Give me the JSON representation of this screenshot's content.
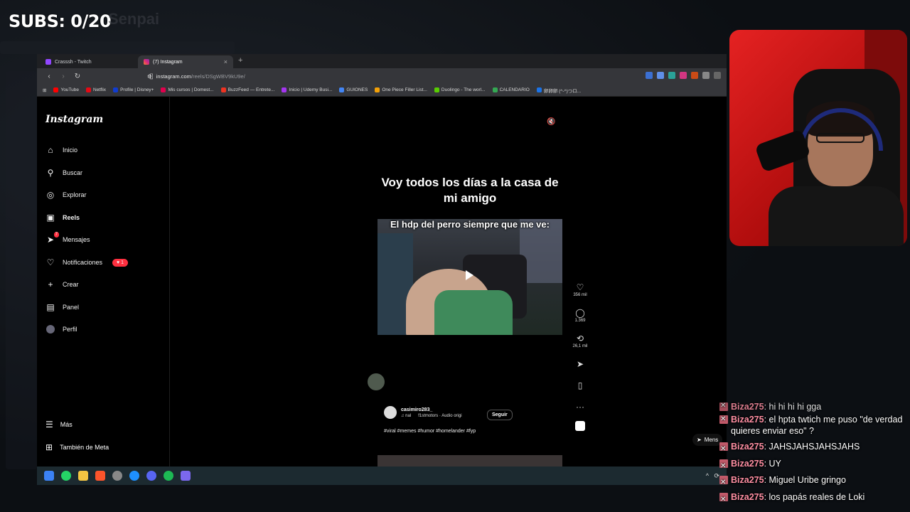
{
  "overlay": {
    "subs_label": "SUBS: 0/20",
    "channel_ghost": "Senpai"
  },
  "browser": {
    "tabs": [
      {
        "label": "Crasssh - Twitch",
        "active": false
      },
      {
        "label": "(7) Instagram",
        "active": true
      }
    ],
    "url_host": "instagram.com",
    "url_path": "/reels/DSgWBV9kU9e/",
    "bookmarks": [
      "YouTube",
      "Netflix",
      "Profile | Disney+",
      "Mis cursos | Domest...",
      "BuzzFeed — Entrete...",
      "Inicio | Udemy Busi...",
      "GUIONES",
      "One Piece Filler List...",
      "Duolingo - The worl...",
      "CALENDARIO",
      "卵卵卵 (^-^)つロ..."
    ]
  },
  "instagram": {
    "logo": "Instagram",
    "nav": [
      {
        "label": "Inicio",
        "icon": "home-icon"
      },
      {
        "label": "Buscar",
        "icon": "search-icon"
      },
      {
        "label": "Explorar",
        "icon": "compass-icon"
      },
      {
        "label": "Reels",
        "icon": "reels-icon"
      },
      {
        "label": "Mensajes",
        "icon": "messages-icon"
      },
      {
        "label": "Notificaciones",
        "icon": "heart-icon"
      },
      {
        "label": "Crear",
        "icon": "plus-icon"
      },
      {
        "label": "Panel",
        "icon": "dashboard-icon"
      },
      {
        "label": "Perfil",
        "icon": "profile-avatar"
      }
    ],
    "messages_badge": "7",
    "notifications_badge": "1",
    "more_label": "Más",
    "meta_label": "También de Meta",
    "reel": {
      "top_caption": "Voy todos los días a la casa de mi amigo",
      "video_caption": "El hdp del perro siempre que me ve:",
      "username": "casimiro283_",
      "audio_prefix": "nal",
      "audio": "f1stmotors · Audio origi",
      "follow_label": "Seguir",
      "hashtags": "#viral #memes #humor #homelander #fyp",
      "likes": "356 mil",
      "comments": "1.369",
      "reposts": "26,1 mil"
    },
    "messages_float_label": "Mens",
    "messages_float_badge": "7"
  },
  "chat": [
    {
      "user": "Biza275",
      "text": "hi hi hi hi gga"
    },
    {
      "user": "Biza275",
      "text": "el hpta twtich me puso \"de verdad quieres enviar eso\" ?"
    },
    {
      "user": "Biza275",
      "text": "JAHSJAHSJAHSJAHS"
    },
    {
      "user": "Biza275",
      "text": "UY"
    },
    {
      "user": "Biza275",
      "text": "Miguel Uribe gringo"
    },
    {
      "user": "Biza275",
      "text": "los papás reales de Loki"
    }
  ],
  "colors": {
    "accent_red": "#ff3040",
    "chat_user": "#ff8fa3",
    "webcam_wall": "#e52222"
  }
}
